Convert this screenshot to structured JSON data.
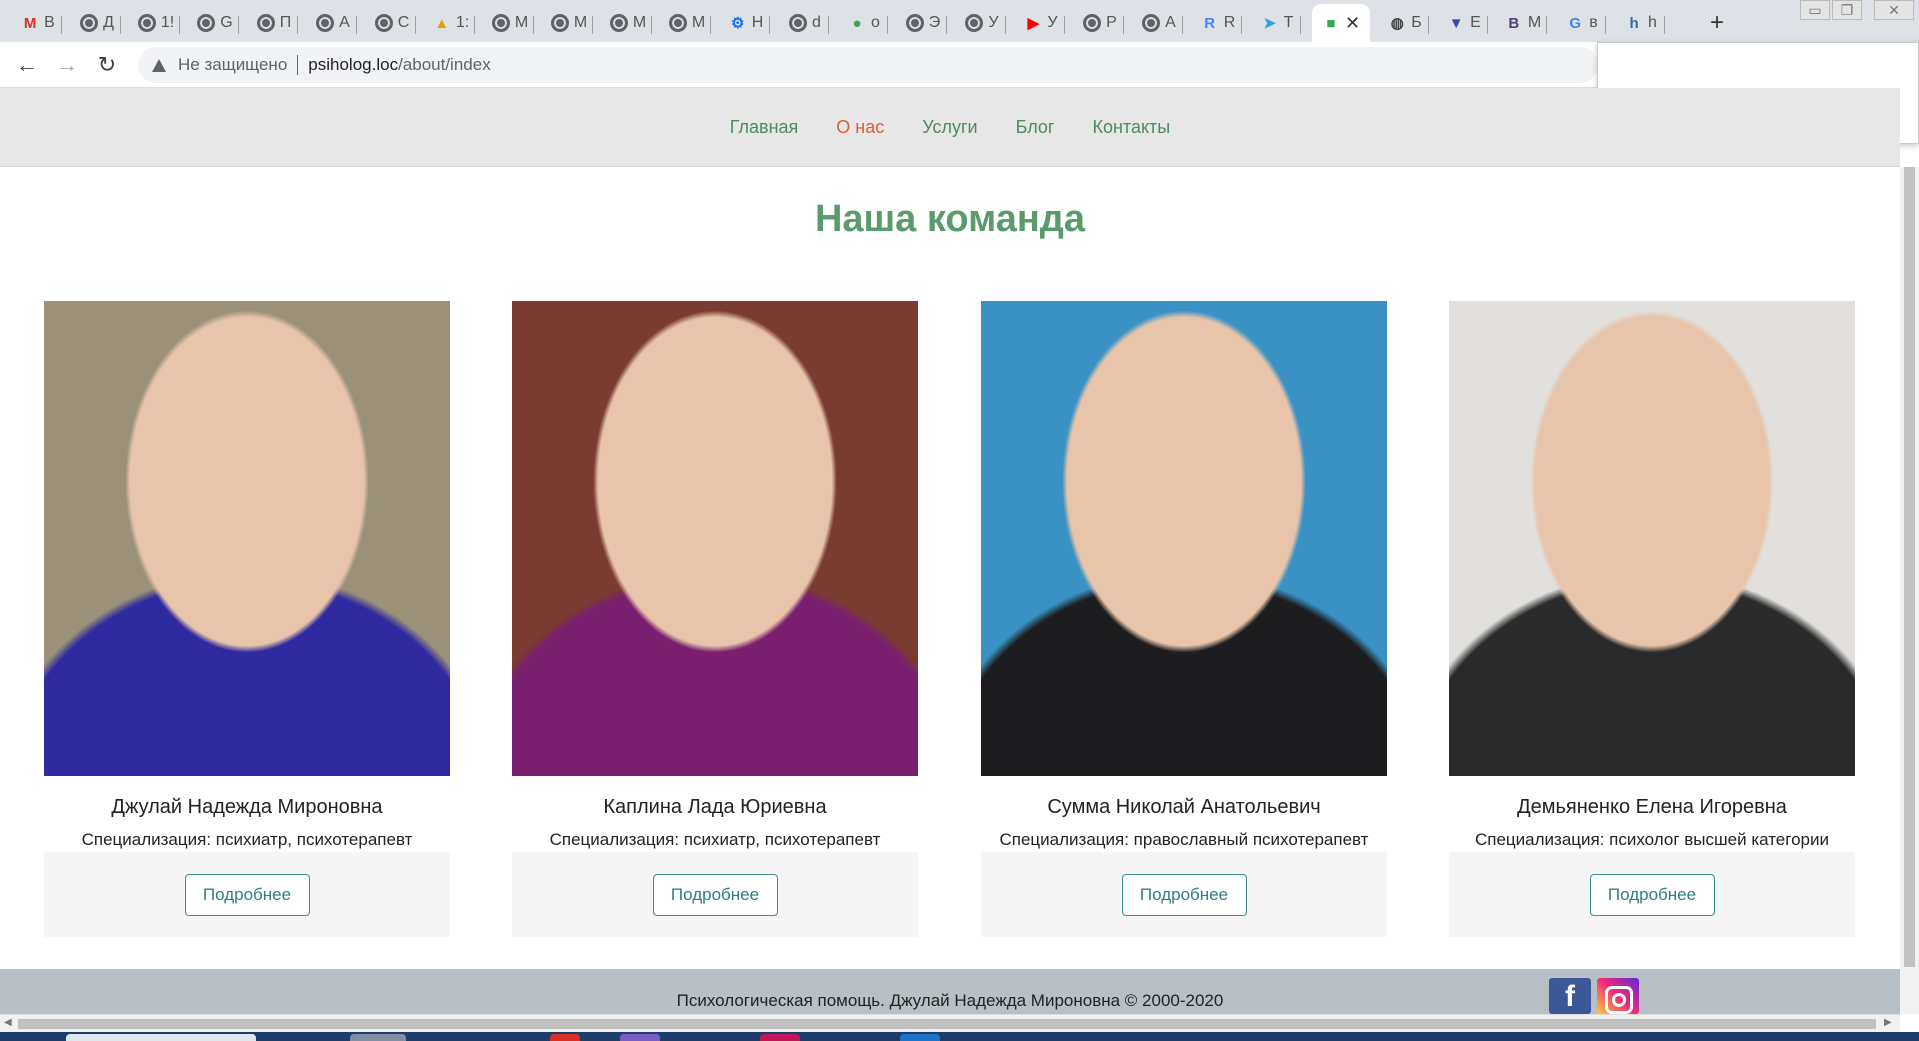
{
  "browser": {
    "tabs": [
      {
        "label": "В",
        "icon": "gmail-icon",
        "color": "#d93025",
        "glyph": "M"
      },
      {
        "label": "Д",
        "icon": "globe-icon"
      },
      {
        "label": "1!",
        "icon": "globe-icon"
      },
      {
        "label": "G",
        "icon": "globe-icon"
      },
      {
        "label": "П",
        "icon": "globe-icon"
      },
      {
        "label": "А",
        "icon": "globe-icon"
      },
      {
        "label": "С",
        "icon": "globe-icon"
      },
      {
        "label": "1:",
        "icon": "rma-icon",
        "color": "#e8a100",
        "glyph": "▲"
      },
      {
        "label": "М",
        "icon": "globe-icon"
      },
      {
        "label": "М",
        "icon": "globe-icon"
      },
      {
        "label": "М",
        "icon": "globe-icon"
      },
      {
        "label": "М",
        "icon": "globe-icon"
      },
      {
        "label": "Н",
        "icon": "gear-icon",
        "color": "#1a73e8",
        "glyph": "⚙"
      },
      {
        "label": "d",
        "icon": "globe-icon"
      },
      {
        "label": "о",
        "icon": "maps-pin-icon",
        "color": "#34a853",
        "glyph": "●"
      },
      {
        "label": "Э",
        "icon": "globe-icon"
      },
      {
        "label": "У",
        "icon": "globe-icon"
      },
      {
        "label": "У",
        "icon": "youtube-icon",
        "color": "#ff0000",
        "glyph": "▶"
      },
      {
        "label": "Р",
        "icon": "globe-icon"
      },
      {
        "label": "А",
        "icon": "globe-icon"
      },
      {
        "label": "R",
        "icon": "r-icon",
        "color": "#4285f4",
        "glyph": "R"
      },
      {
        "label": "Т",
        "icon": "telegram-icon",
        "color": "#2aa3e0",
        "glyph": "➤"
      },
      {
        "label": "",
        "icon": "site-favicon",
        "color": "#34a853",
        "glyph": "■",
        "active": true
      },
      {
        "label": "Б",
        "icon": "web-icon",
        "color": "#444",
        "glyph": "◍"
      },
      {
        "label": "Е",
        "icon": "shield-icon",
        "color": "#3949ab",
        "glyph": "▼"
      },
      {
        "label": "М",
        "icon": "bootstrap-icon",
        "color": "#563d7c",
        "glyph": "B"
      },
      {
        "label": "в",
        "icon": "google-icon",
        "color": "#4285f4",
        "glyph": "G"
      },
      {
        "label": "h",
        "icon": "h-icon",
        "color": "#3367a6",
        "glyph": "h"
      }
    ],
    "close_tab_glyph": "✕",
    "new_tab_glyph": "+",
    "window_controls": [
      "▭",
      "❐",
      "✕"
    ],
    "back_glyph": "←",
    "forward_glyph": "→",
    "reload_glyph": "↻",
    "security_text": "Не защищено",
    "url_host": "psiholog.loc",
    "url_path": "/about/index"
  },
  "nav": {
    "items": [
      {
        "label": "Главная",
        "current": false
      },
      {
        "label": "О нас",
        "current": true
      },
      {
        "label": "Услуги",
        "current": false
      },
      {
        "label": "Блог",
        "current": false
      },
      {
        "label": "Контакты",
        "current": false
      }
    ]
  },
  "team": {
    "title": "Наша команда",
    "more_label": "Подробнее",
    "members": [
      {
        "name": "Джулай Надежда Мироновна",
        "spec": "Специализация: психиатр, психотерапевт",
        "photo_bg": "#9a9178",
        "accent": "#2f2aa0"
      },
      {
        "name": "Каплина Лада Юриевна",
        "spec": "Специализация: психиатр, психотерапевт",
        "photo_bg": "#7a3b30",
        "accent": "#7a1f6f"
      },
      {
        "name": "Сумма Николай Анатольевич",
        "spec": "Специализация: православный психотерапевт",
        "photo_bg": "#3a92c4",
        "accent": "#1d1d1f"
      },
      {
        "name": "Демьяненко Елена Игоревна",
        "spec": "Специализация: психолог высшей категории",
        "photo_bg": "#e2e0dd",
        "accent": "#2a2a2a"
      }
    ]
  },
  "footer": {
    "text": "Психологическая помощь. Джулай Надежда Мироновна © 2000-2020",
    "facebook_glyph": "f"
  }
}
